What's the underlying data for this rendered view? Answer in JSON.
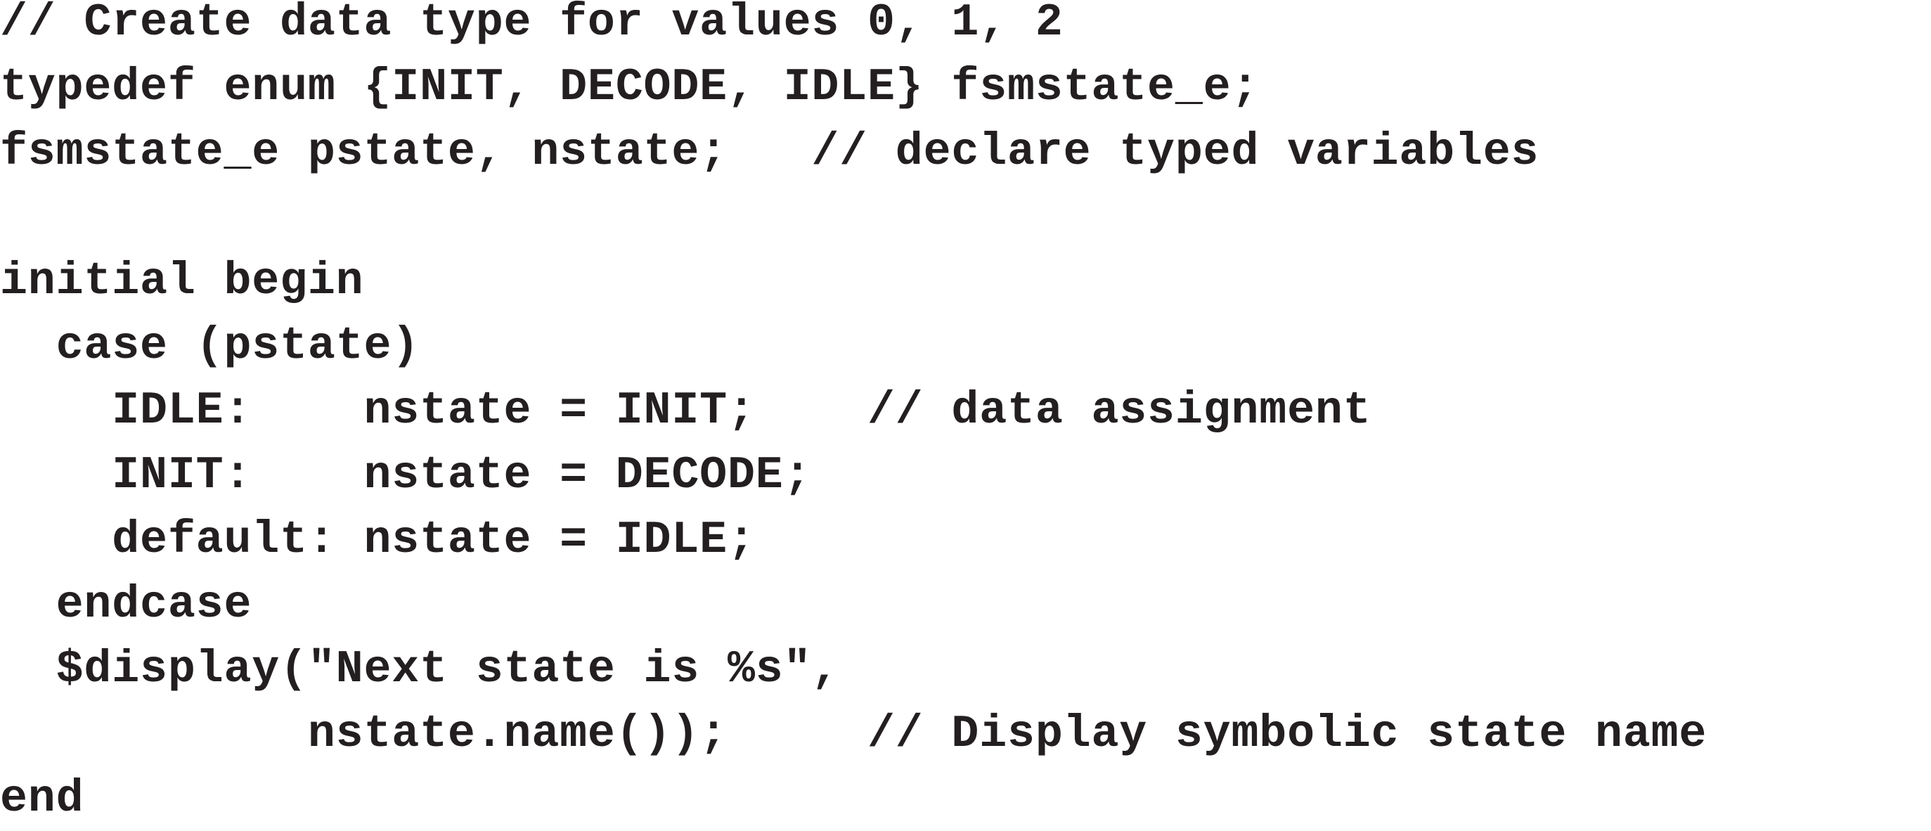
{
  "code": {
    "lines": [
      "// Create data type for values 0, 1, 2",
      "typedef enum {INIT, DECODE, IDLE} fsmstate_e;",
      "fsmstate_e pstate, nstate;   // declare typed variables",
      "",
      "initial begin",
      "  case (pstate)",
      "    IDLE:    nstate = INIT;    // data assignment",
      "    INIT:    nstate = DECODE;",
      "    default: nstate = IDLE;",
      "  endcase",
      "  $display(\"Next state is %s\",",
      "           nstate.name());     // Display symbolic state name",
      "end"
    ]
  }
}
